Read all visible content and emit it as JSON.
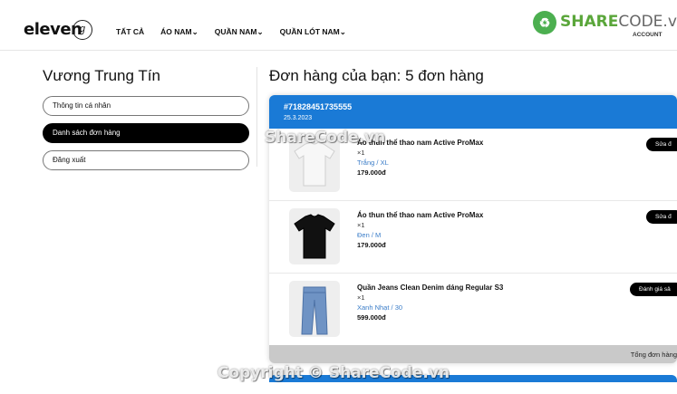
{
  "header": {
    "logo_text": "eleven",
    "logo_mark": "ℊ",
    "nav": [
      "TẤT CẢ",
      "ÁO NAM⌄",
      "QUẦN NAM⌄",
      "QUẦN LÓT NAM⌄"
    ],
    "watermark_brand_a": "SHARE",
    "watermark_brand_b": "CODE.vn",
    "watermark_sub": "ACCOUNT"
  },
  "sidebar": {
    "user_name": "Vương Trung Tín",
    "items": [
      {
        "label": "Thông tin cá nhân",
        "active": false
      },
      {
        "label": "Danh sách đơn hàng",
        "active": true
      },
      {
        "label": "Đăng xuất",
        "active": false
      }
    ]
  },
  "orders": {
    "title": "Đơn hàng của bạn: 5 đơn hàng",
    "order": {
      "id": "#71828451735555",
      "date": "25.3.2023",
      "items": [
        {
          "name": "Áo thun thể thao nam Active ProMax",
          "qty": "×1",
          "variant": "Trắng / XL",
          "price": "179.000đ",
          "action": "Sửa đ",
          "icon": "white-tshirt-icon"
        },
        {
          "name": "Áo thun thể thao nam Active ProMax",
          "qty": "×1",
          "variant": "Đen / M",
          "price": "179.000đ",
          "action": "Sửa đ",
          "icon": "black-tshirt-icon"
        },
        {
          "name": "Quần Jeans Clean Denim dáng Regular S3",
          "qty": "×1",
          "variant": "Xanh Nhạt / 30",
          "price": "599.000đ",
          "action": "Đánh giá sả",
          "icon": "jeans-icon"
        }
      ],
      "total_label": "Tổng đơn hàng"
    }
  },
  "watermarks": {
    "middle": "ShareCode.vn",
    "bottom": "Copyright © ShareCode.vn"
  },
  "colors": {
    "accent_blue": "#1a7ad6",
    "variant_blue": "#3b7dc8",
    "brand_green": "#5aa63a"
  }
}
